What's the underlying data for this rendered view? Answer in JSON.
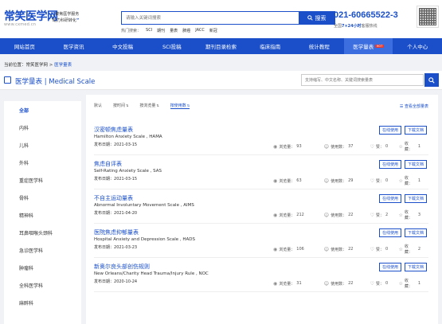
{
  "header": {
    "logo": "常笑医学网",
    "logo_sub": "www.cxmed.cn",
    "slogan_1": "聚焦医学服务",
    "slogan_2": "助力科研转化",
    "search_placeholder": "请输入关键词搜索",
    "search_button": "搜索",
    "hot_label": "热门搜索：",
    "hot_terms": [
      "SCI",
      "期刊",
      "量表",
      "肺癌",
      "JACC",
      "新冠"
    ],
    "phone": "021-60665522-3",
    "phone_sub_pre": "全国",
    "phone_sub_hours": "7×24小时",
    "phone_sub_post": "客服热线"
  },
  "nav": [
    {
      "label": "网站首页",
      "active": false
    },
    {
      "label": "医学资讯",
      "active": false
    },
    {
      "label": "中文投稿",
      "active": false
    },
    {
      "label": "SCI投稿",
      "active": false
    },
    {
      "label": "期刊目录检索",
      "active": false
    },
    {
      "label": "临床指南",
      "active": false
    },
    {
      "label": "统计教程",
      "active": false
    },
    {
      "label": "医学量表",
      "active": true,
      "badge": "HOT"
    },
    {
      "label": "个人中心",
      "active": false
    }
  ],
  "breadcrumb": {
    "prefix": "当前位置：",
    "home": "常笑医学网",
    "sep": " > ",
    "current": "医学量表"
  },
  "page": {
    "title": "医学量表 | Medical Scale",
    "search_placeholder": "支持缩写、中文名称、关键词搜索量表"
  },
  "sidebar": [
    "全部",
    "内科",
    "儿科",
    "外科",
    "重症医学科",
    "骨科",
    "精神科",
    "耳鼻咽喉头颈科",
    "急诊医学科",
    "肿瘤科",
    "全科医学科",
    "麻醉科"
  ],
  "filters": {
    "items": [
      "默认",
      "按时间",
      "按浏览量",
      "按使用数"
    ],
    "selected": 3,
    "view_all": "查看全部量表"
  },
  "labels": {
    "date_prefix": "发布日期：",
    "views": "浏览量：",
    "uses": "使用数：",
    "likes": "赞：",
    "favs": "收藏：",
    "online": "在线使用",
    "download": "下载文档"
  },
  "items": [
    {
      "title": "汉密顿焦虑量表",
      "en": "Hamilton Anxiety Scale , HAMA",
      "date": "2021-03-15",
      "views": "93",
      "uses": "37",
      "likes": "0",
      "favs": "1"
    },
    {
      "title": "焦虑自评表",
      "en": "Self-Rating Anxiety Scale , SAS",
      "date": "2021-03-15",
      "views": "63",
      "uses": "29",
      "likes": "0",
      "favs": "1"
    },
    {
      "title": "不自主运动量表",
      "en": "Abnormal Involuntary Movement Scale , AIMS",
      "date": "2021-04-20",
      "views": "212",
      "uses": "22",
      "likes": "2",
      "favs": "3"
    },
    {
      "title": "医院焦虑抑郁量表",
      "en": "Hospital Anxiety and Depression Scale , HADS",
      "date": "2021-03-23",
      "views": "106",
      "uses": "22",
      "likes": "0",
      "favs": "2"
    },
    {
      "title": "新奥尔良头部创伤规则",
      "en": "New Orleans/Charity Head Trauma/Injury Rule , NOC",
      "date": "2020-10-24",
      "views": "31",
      "uses": "22",
      "likes": "0",
      "favs": "1"
    }
  ]
}
